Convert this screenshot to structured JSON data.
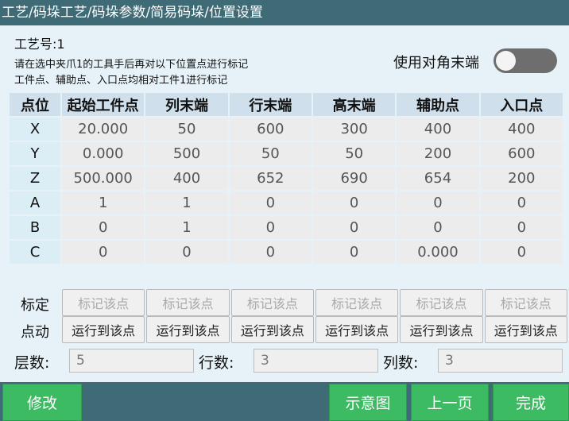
{
  "title": "工艺/码垛工艺/码垛参数/简易码垛/位置设置",
  "info": {
    "craft_number": "工艺号:1",
    "line1": "请在选中夹爪1的工具手后再对以下位置点进行标记",
    "line2": "工件点、辅助点、入口点均相对工件1进行标记"
  },
  "diagonal_toggle": {
    "label": "使用对角末端",
    "on": false
  },
  "table": {
    "headers": [
      "点位",
      "起始工件点",
      "列末端",
      "行末端",
      "高末端",
      "辅助点",
      "入口点"
    ],
    "rows": [
      {
        "axis": "X",
        "values": [
          "20.000",
          "50",
          "600",
          "300",
          "400",
          "400"
        ]
      },
      {
        "axis": "Y",
        "values": [
          "0.000",
          "500",
          "50",
          "50",
          "200",
          "600"
        ]
      },
      {
        "axis": "Z",
        "values": [
          "500.000",
          "400",
          "652",
          "690",
          "654",
          "200"
        ]
      },
      {
        "axis": "A",
        "values": [
          "1",
          "1",
          "0",
          "0",
          "0",
          "0"
        ]
      },
      {
        "axis": "B",
        "values": [
          "0",
          "1",
          "0",
          "0",
          "0",
          "0"
        ]
      },
      {
        "axis": "C",
        "values": [
          "0",
          "0",
          "0",
          "0",
          "0.000",
          "0"
        ]
      }
    ]
  },
  "mark_row": {
    "label": "标定",
    "button": "标记该点"
  },
  "move_row": {
    "label": "点动",
    "button": "运行到该点"
  },
  "fields": {
    "layers": {
      "label": "层数:",
      "value": "5"
    },
    "rows": {
      "label": "行数:",
      "value": "3"
    },
    "cols": {
      "label": "列数:",
      "value": "3"
    }
  },
  "footer": {
    "modify": "修改",
    "diagram": "示意图",
    "prev": "上一页",
    "done": "完成"
  }
}
